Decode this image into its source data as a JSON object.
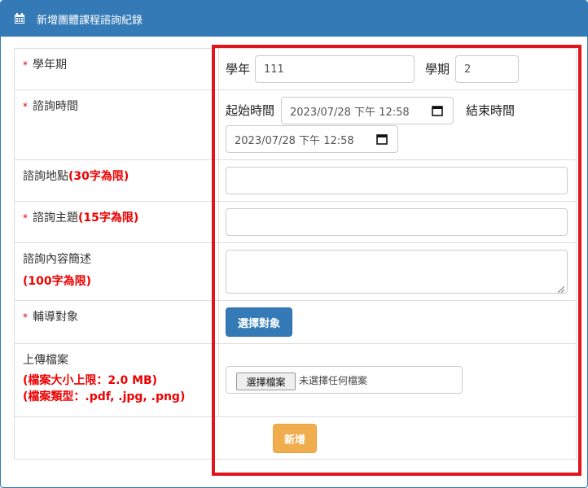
{
  "header": {
    "title": "新增團體課程諮詢紀錄",
    "icon": "calendar-icon"
  },
  "form": {
    "school_year": {
      "label": "學年期",
      "required_mark": "*",
      "year_label": "學年",
      "year_value": "111",
      "term_label": "學期",
      "term_value": "2"
    },
    "time": {
      "label": "諮詢時間",
      "required_mark": "*",
      "start_label": "起始時間",
      "start_value": "2023/07/28 下午 12:58",
      "end_label": "結束時間",
      "end_value": "2023/07/28 下午 12:58"
    },
    "location": {
      "label": "諮詢地點",
      "limit": "(30字為限)",
      "value": ""
    },
    "topic": {
      "label": "諮詢主題",
      "required_mark": "*",
      "limit": "(15字為限)",
      "value": ""
    },
    "summary": {
      "label": "諮詢內容簡述",
      "limit": "(100字為限)",
      "value": ""
    },
    "target": {
      "label": "輔導對象",
      "required_mark": "*",
      "button": "選擇對象"
    },
    "upload": {
      "label": "上傳檔案",
      "size_limit": "(檔案大小上限：2.0 MB)",
      "type_limit": "(檔案類型：.pdf, .jpg, .png)",
      "choose_button": "選擇檔案",
      "no_file_text": "未選擇任何檔案"
    },
    "submit_button": "新增"
  },
  "colors": {
    "header_bg": "#337ab7",
    "primary_button": "#337ab7",
    "warning_button": "#f0ad4e",
    "required_red": "#e00000",
    "highlight_red": "#e0161e"
  }
}
